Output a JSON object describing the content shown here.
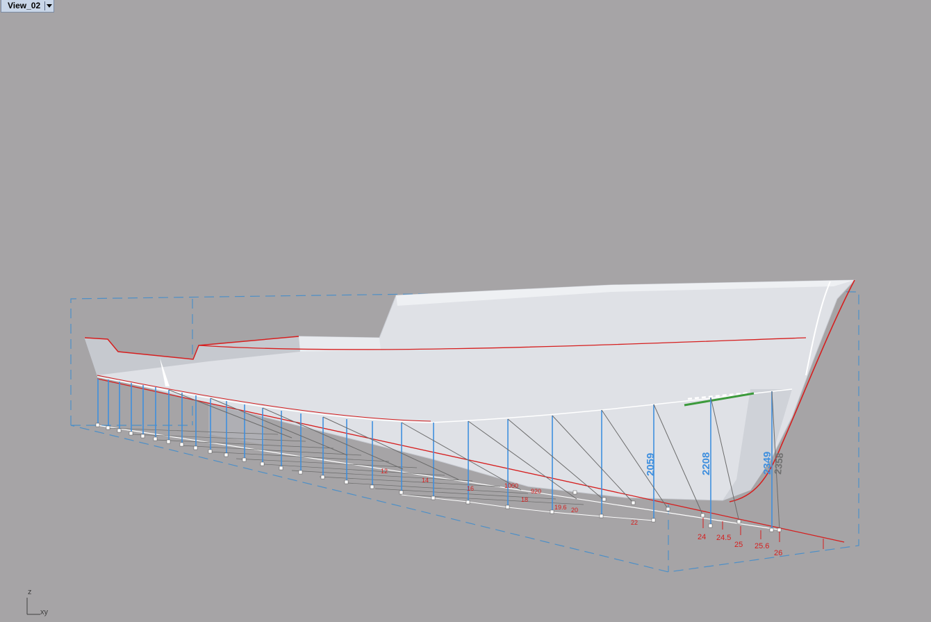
{
  "viewport": {
    "title": "View_02",
    "menu_icon": "chevron-down-icon",
    "background": "#a6a4a6"
  },
  "axes": {
    "z_label": "z",
    "xy_label": "xy"
  },
  "colors": {
    "hull": "#dfe1e6",
    "outline": "#d61e1e",
    "dimension_blue": "#3f8fde",
    "dimension_gray": "#707070",
    "bounding_box": "#4d8fc7",
    "highlight_green": "#3c9a3c"
  },
  "dimensions": {
    "blue": [
      "2059",
      "2208",
      "2349"
    ],
    "gray": [
      "2358"
    ]
  },
  "stations": [
    "24",
    "24.5",
    "25",
    "25.6",
    "26"
  ],
  "minor_labels": [
    "12",
    "14",
    "16",
    "18",
    "19.6",
    "20",
    "22",
    "1000",
    "920"
  ]
}
